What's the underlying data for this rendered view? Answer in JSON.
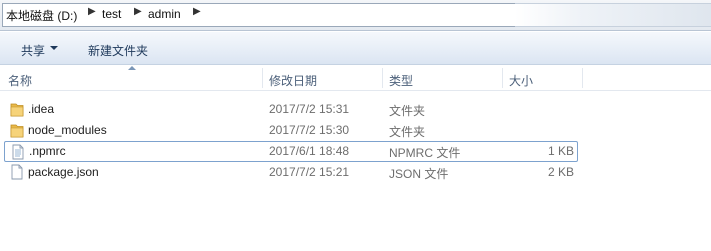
{
  "address": {
    "breadcrumbs": [
      "本地磁盘 (D:)",
      "test",
      "admin"
    ]
  },
  "toolbar": {
    "organize_label": "共享",
    "new_folder_label": "新建文件夹"
  },
  "columns": [
    "名称",
    "修改日期",
    "类型",
    "大小"
  ],
  "files": [
    {
      "name": ".idea",
      "modified": "2017/7/2 15:31",
      "type": "文件夹",
      "size": "",
      "icon": "folder-icon"
    },
    {
      "name": "node_modules",
      "modified": "2017/7/2 15:30",
      "type": "文件夹",
      "size": "",
      "icon": "folder-icon"
    },
    {
      "name": ".npmrc",
      "modified": "2017/6/1 18:48",
      "type": "NPMRC 文件",
      "size": "1 KB",
      "icon": "text-file-icon"
    },
    {
      "name": "package.json",
      "modified": "2017/7/2 15:21",
      "type": "JSON 文件",
      "size": "2 KB",
      "icon": "file-icon"
    }
  ]
}
